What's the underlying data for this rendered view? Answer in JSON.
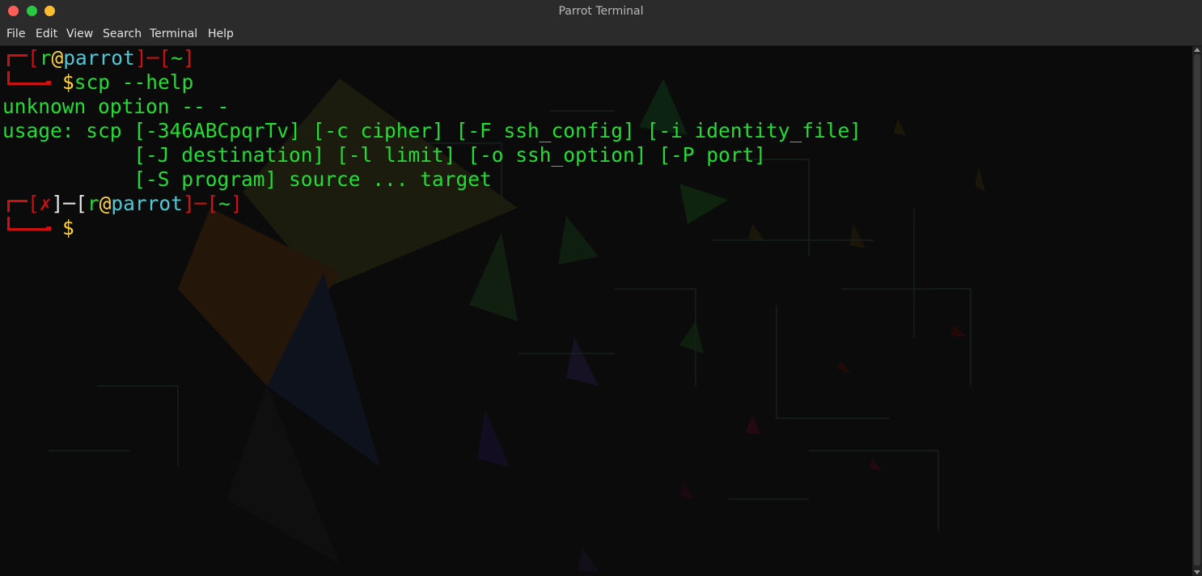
{
  "window": {
    "title": "Parrot Terminal"
  },
  "menu": [
    "File",
    "Edit",
    "View",
    "Search",
    "Terminal",
    "Help"
  ],
  "prompt1": {
    "open": "[",
    "user": "r",
    "at": "@",
    "host": "parrot",
    "close": "]",
    "dash": "─",
    "dir_open": "[",
    "dir": "~",
    "dir_close": "]",
    "dollar": "$",
    "command": "scp --help"
  },
  "output": [
    "unknown option -- -",
    "usage: scp [-346ABCpqrTv] [-c cipher] [-F ssh_config] [-i identity_file]",
    "           [-J destination] [-l limit] [-o ssh_option] [-P port]",
    "           [-S program] source ... target"
  ],
  "prompt2": {
    "err_open": "[",
    "err": "✗",
    "err_close": "]",
    "dash": "─",
    "open": "[",
    "user": "r",
    "at": "@",
    "host": "parrot",
    "close": "]",
    "dir_open": "[",
    "dir": "~",
    "dir_close": "]",
    "dollar": "$"
  },
  "colors": {
    "prompt_frame": "#d01010",
    "output": "#22dd33",
    "dollar": "#ffd43b",
    "host": "#4fc8d6"
  }
}
